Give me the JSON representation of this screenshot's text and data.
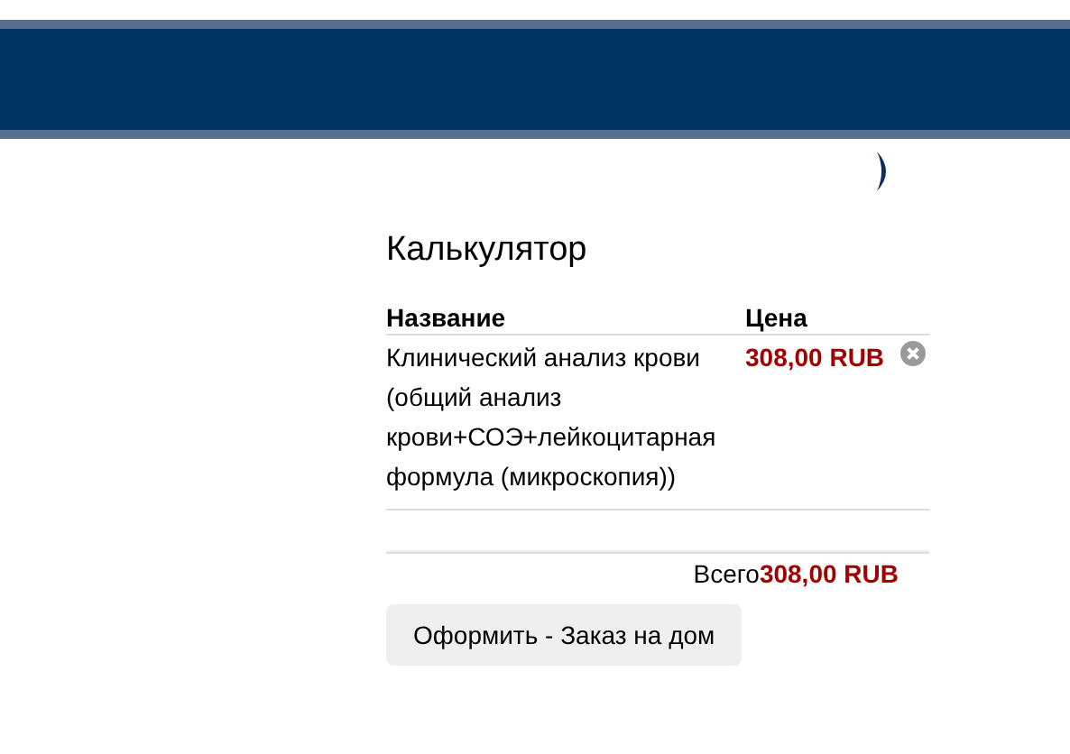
{
  "calculator": {
    "title": "Калькулятор",
    "columns": [
      "Название",
      "Цена"
    ],
    "rows": [
      {
        "name": "Клинический анализ крови (общий анализ крови+СОЭ+лейкоцитарная формула (микроскопия))",
        "price": "308,00 RUB"
      }
    ],
    "total_label": "Всего",
    "total_value": "308,00 RUB",
    "button": "Оформить - Заказ на дом"
  }
}
